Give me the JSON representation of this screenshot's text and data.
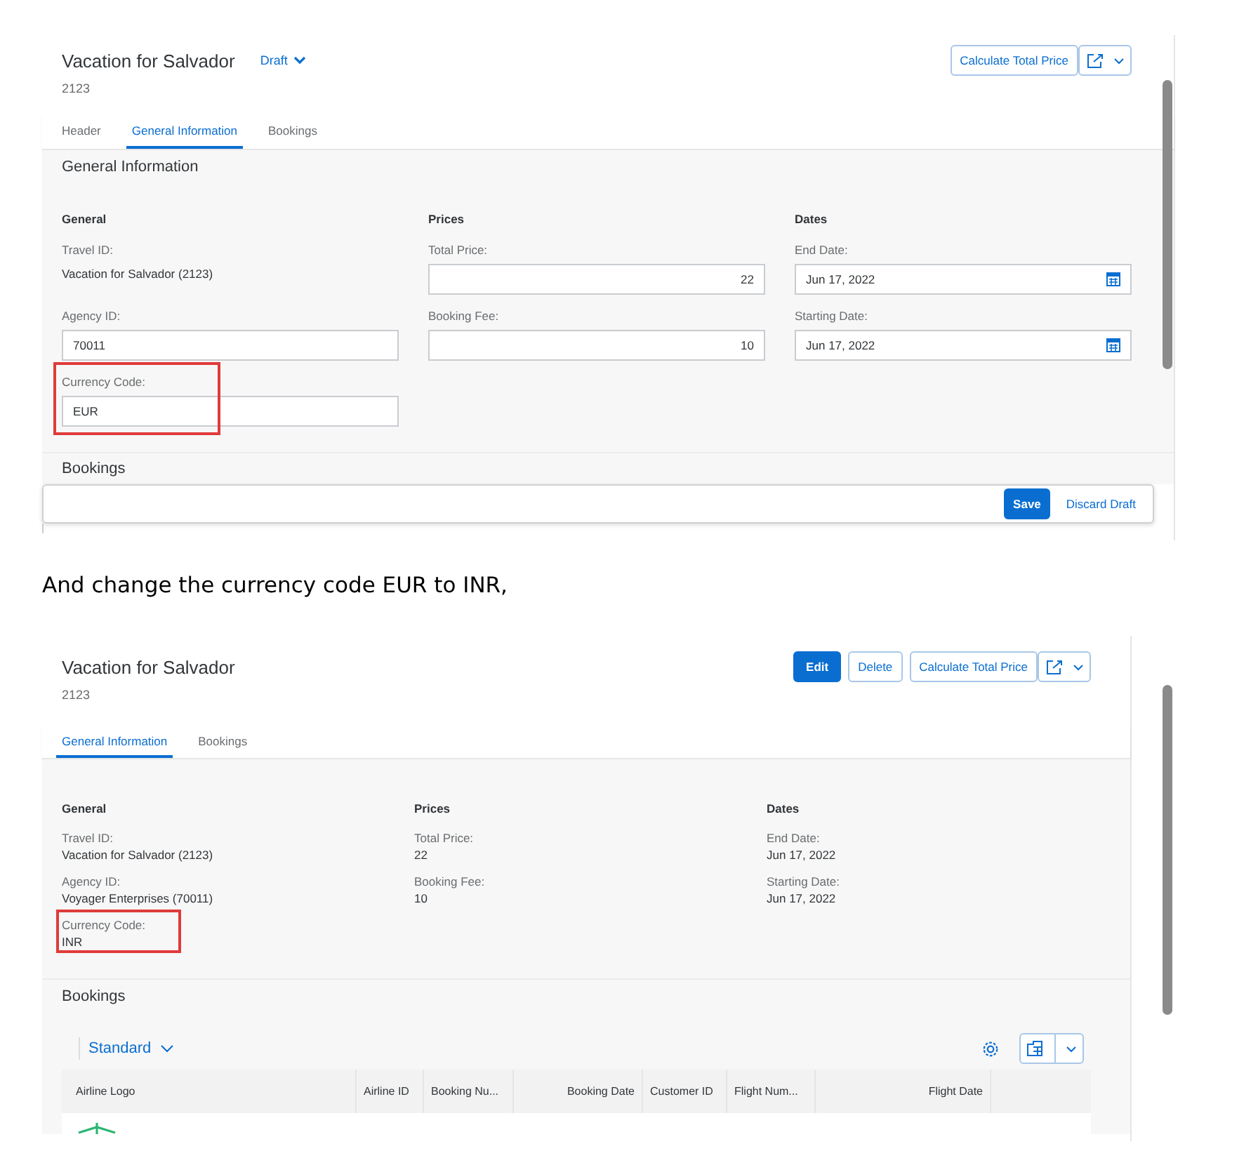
{
  "screenshots": [
    {
      "title": "Vacation for Salvador",
      "status": "Draft",
      "subtitle": "2123",
      "actions": [
        {
          "label": "Calculate Total Price",
          "kind": "default"
        }
      ],
      "tabs": [
        {
          "label": "Header",
          "selected": false
        },
        {
          "label": "General Information",
          "selected": true
        },
        {
          "label": "Bookings",
          "selected": false
        }
      ],
      "section_title": "General Information",
      "groups": [
        {
          "title": "General",
          "fields": [
            {
              "label": "Travel ID:",
              "value": "Vacation for Salvador (2123)",
              "kind": "text",
              "highlighted": false
            },
            {
              "label": "Agency ID:",
              "value": "70011",
              "kind": "input",
              "highlighted": false
            },
            {
              "label": "Currency Code:",
              "value": "EUR",
              "kind": "input",
              "highlighted": true
            }
          ]
        },
        {
          "title": "Prices",
          "fields": [
            {
              "label": "Total Price:",
              "value": "22",
              "kind": "number",
              "highlighted": false
            },
            {
              "label": "Booking Fee:",
              "value": "10",
              "kind": "number",
              "highlighted": false
            }
          ]
        },
        {
          "title": "Dates",
          "fields": [
            {
              "label": "End Date:",
              "value": "Jun 17, 2022",
              "kind": "date",
              "highlighted": false
            },
            {
              "label": "Starting Date:",
              "value": "Jun 17, 2022",
              "kind": "date",
              "highlighted": false
            }
          ]
        }
      ],
      "bookings_title": "Bookings",
      "footer_buttons": [
        {
          "label": "Save",
          "kind": "emphasized"
        },
        {
          "label": "Discard Draft",
          "kind": "transparent"
        }
      ]
    },
    {
      "title": "Vacation for Salvador",
      "subtitle": "2123",
      "actions": [
        {
          "label": "Edit",
          "kind": "emphasized"
        },
        {
          "label": "Delete",
          "kind": "default"
        },
        {
          "label": "Calculate Total Price",
          "kind": "default"
        }
      ],
      "tabs": [
        {
          "label": "General Information",
          "selected": true
        },
        {
          "label": "Bookings",
          "selected": false
        }
      ],
      "groups": [
        {
          "title": "General",
          "fields": [
            {
              "label": "Travel ID:",
              "value": "Vacation for Salvador (2123)",
              "kind": "text",
              "highlighted": false
            },
            {
              "label": "Agency ID:",
              "value": "Voyager Enterprises (70011)",
              "kind": "text",
              "highlighted": false
            },
            {
              "label": "Currency Code:",
              "value": "INR",
              "kind": "text",
              "highlighted": true
            }
          ]
        },
        {
          "title": "Prices",
          "fields": [
            {
              "label": "Total Price:",
              "value": "22",
              "kind": "text",
              "highlighted": false
            },
            {
              "label": "Booking Fee:",
              "value": "10",
              "kind": "text",
              "highlighted": false
            }
          ]
        },
        {
          "title": "Dates",
          "fields": [
            {
              "label": "End Date:",
              "value": "Jun 17, 2022",
              "kind": "text",
              "highlighted": false
            },
            {
              "label": "Starting Date:",
              "value": "Jun 17, 2022",
              "kind": "text",
              "highlighted": false
            }
          ]
        }
      ],
      "bookings_title": "Bookings",
      "table": {
        "variant": "Standard",
        "columns": [
          "Airline Logo",
          "Airline ID",
          "Booking Nu...",
          "Booking Date",
          "Customer ID",
          "Flight Num...",
          "Flight Date"
        ]
      }
    }
  ],
  "caption": "And change the currency code EUR to INR,"
}
